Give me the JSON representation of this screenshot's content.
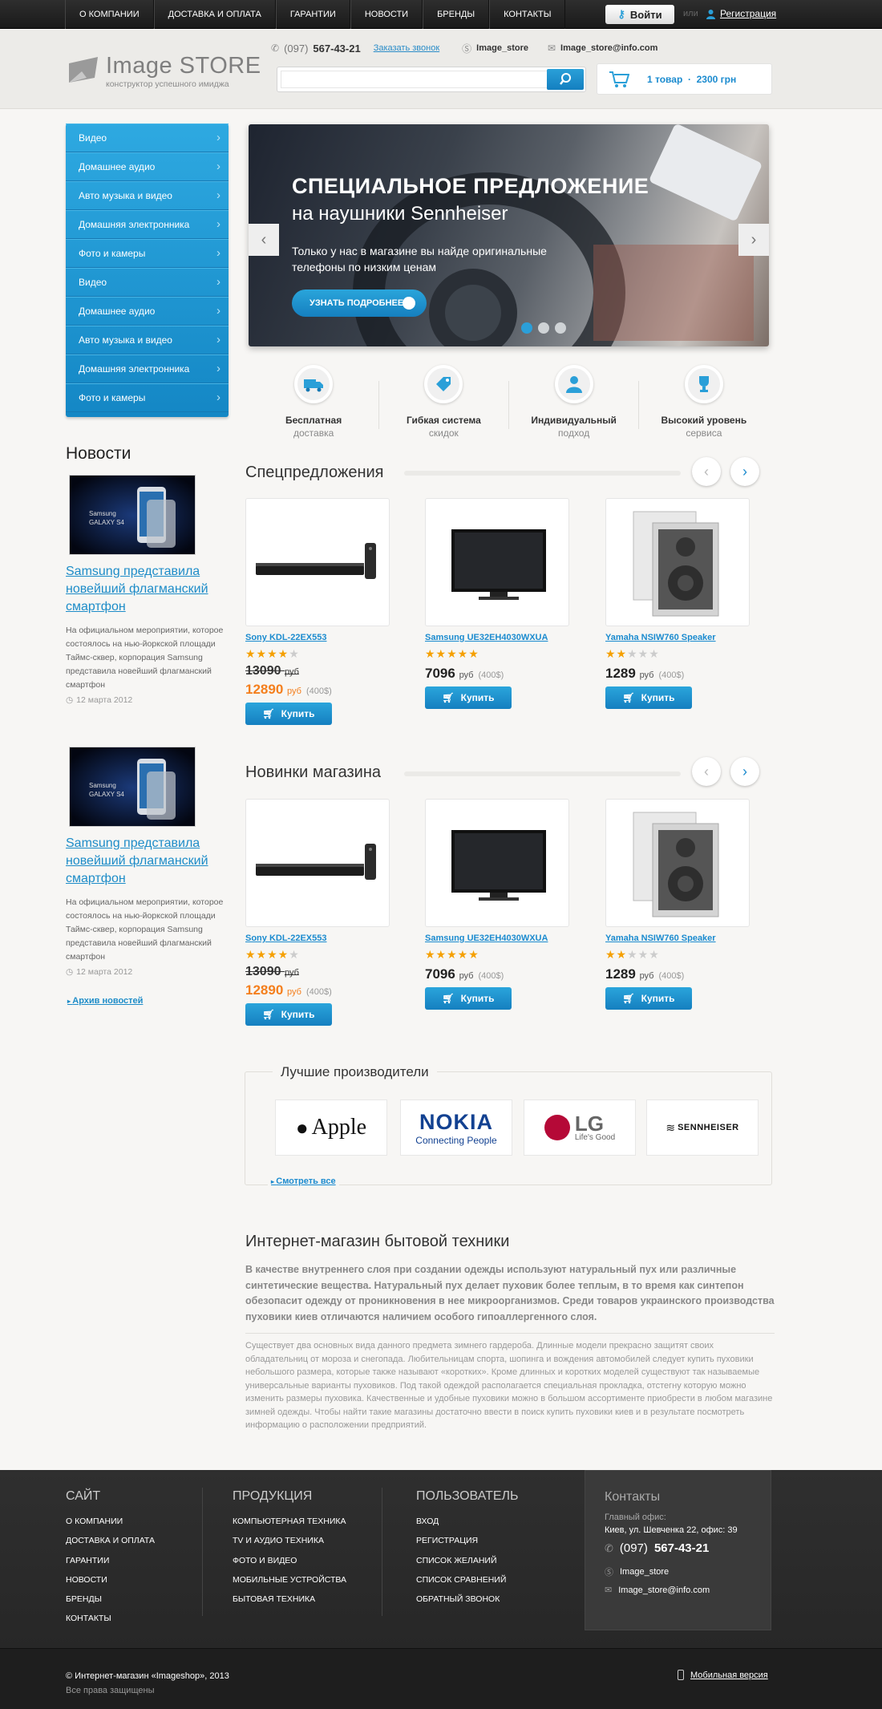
{
  "topnav": [
    "О КОМПАНИИ",
    "ДОСТАВКА И ОПЛАТА",
    "ГАРАНТИИ",
    "НОВОСТИ",
    "БРЕНДЫ",
    "КОНТАКТЫ"
  ],
  "auth": {
    "login": "Войти",
    "or": "или",
    "register": "Регистрация"
  },
  "logo": {
    "name": "Image STORE",
    "tagline": "конструктор успешного имиджа"
  },
  "contacts": {
    "phone_code": "(097)",
    "phone": "567-43-21",
    "callback": "Заказать звонок",
    "skype": "Image_store",
    "email": "Image_store@info.com"
  },
  "search": {
    "placeholder": ""
  },
  "cart": {
    "summary": "1 товар  ·  2300 грн"
  },
  "sidebar": [
    "Видео",
    "Домашнее аудио",
    "Авто музыка и видео",
    "Домашняя электронника",
    "Фото и камеры",
    "Видео",
    "Домашнее аудио",
    "Авто музыка и видео",
    "Домашняя электронника",
    "Фото и камеры"
  ],
  "banner": {
    "title": "СПЕЦИАЛЬНОЕ ПРЕДЛОЖЕНИЕ",
    "subtitle": "на наушники Sennheiser",
    "text": "Только у нас в магазине вы найде оригинальные телефоны по низким ценам",
    "button": "УЗНАТЬ ПОДРОБНЕЕ"
  },
  "features": [
    {
      "line1": "Бесплатная",
      "line2": "доставка",
      "icon": "truck-icon"
    },
    {
      "line1": "Гибкая система",
      "line2": "скидок",
      "icon": "discount-tag-icon"
    },
    {
      "line1": "Индивидуальный",
      "line2": "подход",
      "icon": "person-icon"
    },
    {
      "line1": "Высокий уровень",
      "line2": "сервиса",
      "icon": "trophy-icon"
    }
  ],
  "news": {
    "title": "Новости",
    "items": [
      {
        "headline": "Samsung представила новейший флагманский смартфон",
        "text": "На официальном мероприятии, которое состоялось на нью-йоркской площади Таймс-сквер, корпорация Samsung представила новейший флагманский смартфон",
        "date": "12 марта 2012",
        "img_caption": "Samsung GALAXY S4"
      },
      {
        "headline": "Samsung представила новейший флагманский смартфон",
        "text": "На официальном мероприятии, которое состоялось на нью-йоркской площади Таймс-сквер, корпорация Samsung представила новейший флагманский смартфон",
        "date": "12 марта 2012",
        "img_caption": "Samsung GALAXY S4"
      }
    ],
    "archive": "Архив новостей"
  },
  "sections": {
    "special": "Спецпредложения",
    "new": "Новинки магазина"
  },
  "products": [
    {
      "name": "Sony KDL-22EX553",
      "rating": 4,
      "old_price": "13090",
      "price": "12890",
      "currency": "руб",
      "usd": "(400$)",
      "buy": "Купить"
    },
    {
      "name": "Samsung UE32EH4030WXUA",
      "rating": 5,
      "old_price": "",
      "price": "7096",
      "currency": "руб",
      "usd": "(400$)",
      "buy": "Купить"
    },
    {
      "name": "Yamaha NSIW760 Speaker",
      "rating": 2,
      "old_price": "",
      "price": "1289",
      "currency": "руб",
      "usd": "(400$)",
      "buy": "Купить"
    }
  ],
  "brands": {
    "title": "Лучшие производители",
    "items": [
      "Apple",
      "NOKIA",
      "Connecting People",
      "LG",
      "Life's Good",
      "SENNHEISER"
    ],
    "see_all": "Смотреть все"
  },
  "about": {
    "title": "Интернет-магазин бытовой техники",
    "lead": "В качестве внутреннего слоя при создании одежды используют натуральный пух или различные синтетические вещества. Натуральный пух делает пуховик более теплым, в то время как синтепон обезопасит одежду от проникновения в нее микроорганизмов. Среди товаров украинского производства пуховики киев отличаются наличием особого гипоаллергенного слоя.",
    "text": "Существует два основных вида данного предмета зимнего гардероба. Длинные модели прекрасно защитят своих обладательниц от мороза и снегопада. Любительницам спорта, шопинга и вождения автомобилей следует купить пуховики небольшого размера, которые также называют «коротких». Кроме длинных и коротких моделей существуют так называемые универсальные варианты пуховиков. Под такой одеждой располагается специальная прокладка, отстегну которую можно изменить размеры пуховика. Качественные и удобные пуховики можно в большом ассортименте приобрести в любом магазине зимней одежды. Чтобы найти такие магазины достаточно ввести в поиск купить пуховики киев и в результате посмотреть информацию о расположении предприятий."
  },
  "footer": {
    "site": {
      "title": "САЙТ",
      "links": [
        "О КОМПАНИИ",
        "ДОСТАВКА И ОПЛАТА",
        "ГАРАНТИИ",
        "НОВОСТИ",
        "БРЕНДЫ",
        "КОНТАКТЫ"
      ]
    },
    "products": {
      "title": "ПРОДУКЦИЯ",
      "links": [
        "КОМПЬЮТЕРНАЯ ТЕХНИКА",
        "TV И АУДИО ТЕХНИКА",
        "ФОТО И ВИДЕО",
        "МОБИЛЬНЫЕ УСТРОЙСТВА",
        "БЫТОВАЯ ТЕХНИКА"
      ]
    },
    "user": {
      "title": "ПОЛЬЗОВАТЕЛЬ",
      "links": [
        "ВХОД",
        "РЕГИСТРАЦИЯ",
        "СПИСОК ЖЕЛАНИЙ",
        "СПИСОК СРАВНЕНИЙ",
        "ОБРАТНЫЙ ЗВОНОК"
      ]
    },
    "contacts": {
      "title": "Контакты",
      "label": "Главный офис:",
      "address": "Киев, ул. Шевченка 22, офис: 39",
      "phone_code": "(097)",
      "phone": "567-43-21",
      "skype": "Image_store",
      "email": "Image_store@info.com"
    },
    "copyright": "© Интернет-магазин «Imageshop»,  2013",
    "rights": "Все права защищены",
    "mobile": "Мобильная версия"
  },
  "colors": {
    "accent": "#1b8bcf",
    "sale": "#f47f1d",
    "footer": "#2c2c2c"
  }
}
